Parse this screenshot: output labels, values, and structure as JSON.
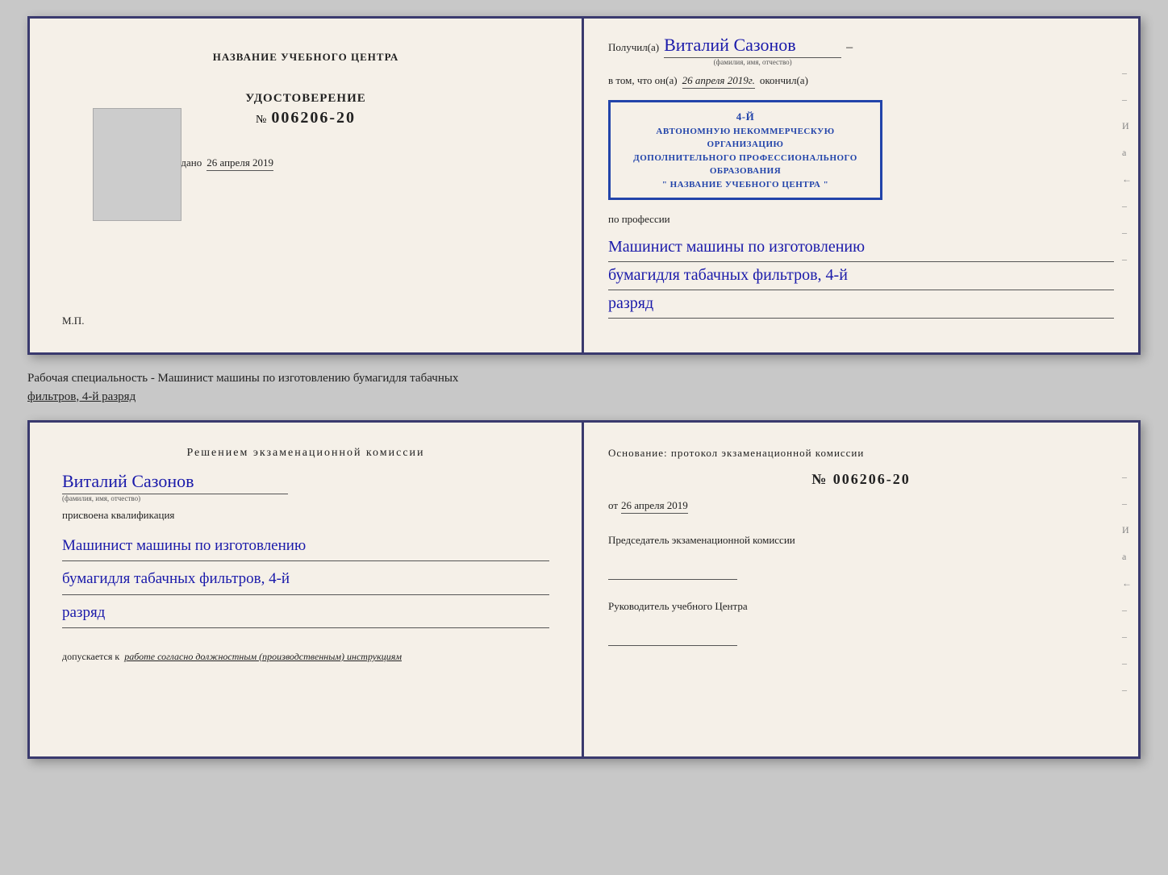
{
  "top_cert": {
    "left": {
      "training_center_label": "НАЗВАНИЕ УЧЕБНОГО ЦЕНТРА",
      "udostoverenie_title": "УДОСТОВЕРЕНИЕ",
      "number_prefix": "№",
      "number": "006206-20",
      "vydano_label": "Выдано",
      "vydano_date": "26 апреля 2019",
      "mp_label": "М.П."
    },
    "right": {
      "poluchil_label": "Получил(а)",
      "recipient_name": "Виталий Сазонов",
      "fio_sub": "(фамилия, имя, отчество)",
      "vtom_label": "в том, что он(а)",
      "vtom_date": "26 апреля 2019г.",
      "okonchil_label": "окончил(а)",
      "stamp_line1": "4-й",
      "stamp_line2": "АВТОНОМНУЮ НЕКОММЕРЧЕСКУЮ ОРГАНИЗАЦИЮ",
      "stamp_line3": "ДОПОЛНИТЕЛЬНОГО ПРОФЕССИОНАЛЬНОГО ОБРАЗОВАНИЯ",
      "stamp_line4": "\" НАЗВАНИЕ УЧЕБНОГО ЦЕНТРА \"",
      "po_professii_label": "по профессии",
      "profession_line1": "Машинист машины по изготовлению",
      "profession_line2": "бумагидля табачных фильтров, 4-й",
      "profession_line3": "разряд"
    }
  },
  "specialty_text": {
    "main": "Рабочая специальность - Машинист машины по изготовлению бумагидля табачных",
    "underlined": "фильтров, 4-й разряд"
  },
  "bottom_cert": {
    "left": {
      "resheniem_label": "Решением экзаменационной комиссии",
      "recipient_name": "Виталий Сазонов",
      "fio_sub": "(фамилия, имя, отчество)",
      "prisvoena_label": "присвоена квалификация",
      "profession_line1": "Машинист машины по изготовлению",
      "profession_line2": "бумагидля табачных фильтров, 4-й",
      "profession_line3": "разряд",
      "dopuskaetsya_label": "допускается к",
      "dopuskaetsya_value": "работе согласно должностным (производственным) инструкциям"
    },
    "right": {
      "osnovanie_label": "Основание: протокол экзаменационной комиссии",
      "number_prefix": "№",
      "number": "006206-20",
      "ot_label": "от",
      "ot_date": "26 апреля 2019",
      "predsedatel_label": "Председатель экзаменационной комиссии",
      "rukovoditel_label": "Руководитель учебного Центра"
    }
  },
  "deco": {
    "right_chars": [
      "–",
      "–",
      "И",
      "а",
      "←",
      "–",
      "–",
      "–",
      "–",
      "–"
    ]
  }
}
